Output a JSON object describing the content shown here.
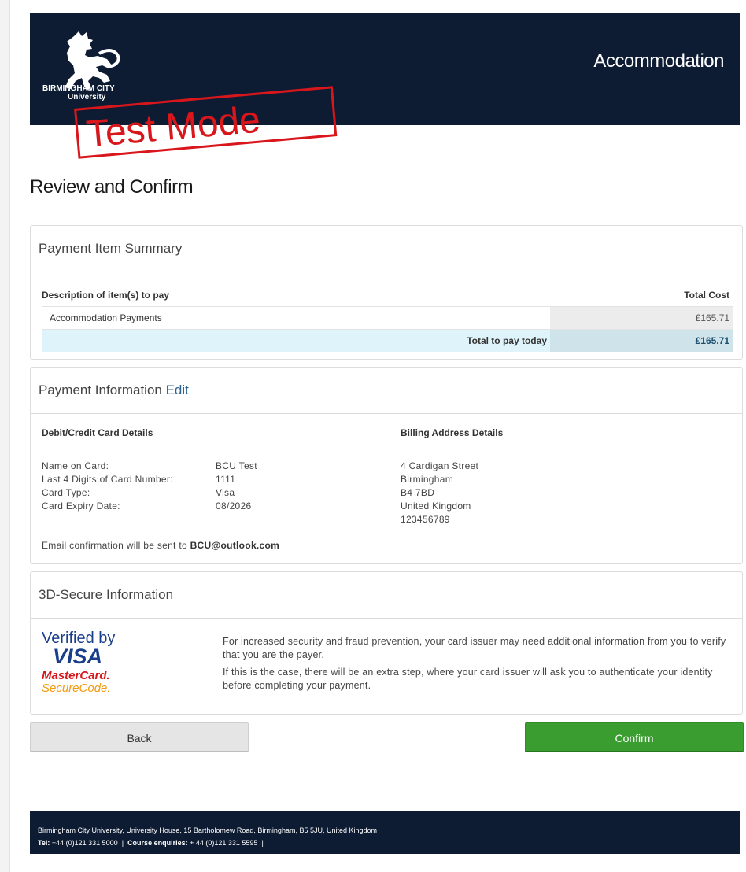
{
  "header": {
    "logo_line1": "BIRMINGHAM CITY",
    "logo_line2": "University",
    "title": "Accommodation"
  },
  "stamp": "Test Mode",
  "page_title": "Review and Confirm",
  "summary": {
    "heading": "Payment Item Summary",
    "col_description": "Description of item(s) to pay",
    "col_total": "Total Cost",
    "item_description": "Accommodation Payments",
    "item_cost": "£165.71",
    "total_label": "Total to pay today",
    "total_value": "£165.71"
  },
  "payment_info": {
    "heading": "Payment Information",
    "edit_label": "Edit",
    "card_heading": "Debit/Credit Card Details",
    "billing_heading": "Billing Address Details",
    "name_label": "Name on Card:",
    "name_value": "BCU Test",
    "last4_label": "Last 4 Digits of Card Number:",
    "last4_value": "1111",
    "type_label": "Card Type:",
    "type_value": "Visa",
    "expiry_label": "Card Expiry Date:",
    "expiry_value": "08/2026",
    "address": [
      "4 Cardigan Street",
      "Birmingham",
      "B4 7BD",
      "United Kingdom",
      "123456789"
    ],
    "email_prefix": "Email confirmation will be sent to",
    "email": "BCU@outlook.com"
  },
  "secure": {
    "heading": "3D-Secure Information",
    "logo_verified": "Verified by",
    "logo_visa": "VISA",
    "logo_mastercard": "MasterCard.",
    "logo_securecode": "SecureCode.",
    "text1": "For increased security and fraud prevention, your card issuer may need additional information from you to verify that you are the payer.",
    "text2": "If this is the case, there will be an extra step, where your card issuer will ask you to authenticate your identity before completing your payment."
  },
  "buttons": {
    "back": "Back",
    "confirm": "Confirm"
  },
  "footer": {
    "address": "Birmingham City University, University House, 15 Bartholomew Road, Birmingham, B5 5JU, United Kingdom",
    "tel_label": "Tel:",
    "tel": "+44 (0)121 331 5000",
    "course_label": "Course enquiries:",
    "course": "+ 44 (0)121 331 5595",
    "sep": "|"
  },
  "colors": {
    "header_bg": "#0d1c33",
    "stamp_red": "#d9161b",
    "confirm_green": "#3a9d30",
    "total_row": "#dff4fa",
    "link_blue": "#2a6496"
  }
}
